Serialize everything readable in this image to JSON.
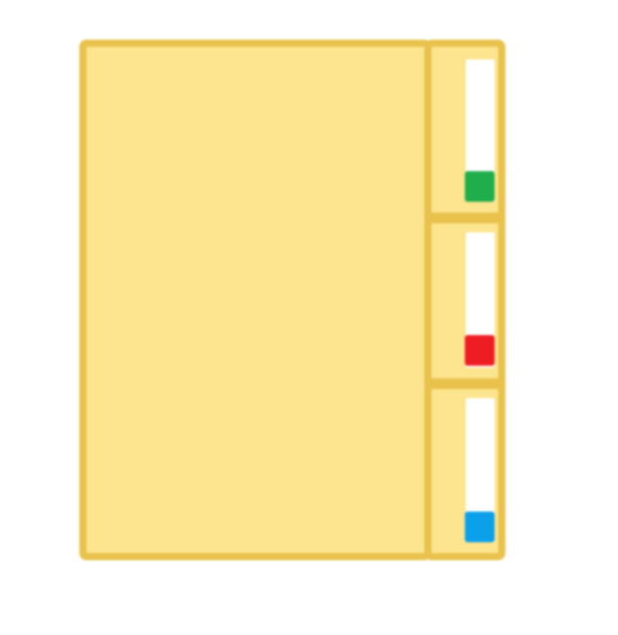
{
  "icon": {
    "name": "split-panel-icon",
    "colors": {
      "background": "#ffffff",
      "panel_fill": "#fde48e",
      "panel_border": "#e8c24c",
      "slot_fill": "#ffffff",
      "indicator_top": "#1fae4b",
      "indicator_middle": "#ee1d24",
      "indicator_bottom": "#0aa0ea"
    },
    "indicators": [
      {
        "name": "green-indicator",
        "color_key": "indicator_top"
      },
      {
        "name": "red-indicator",
        "color_key": "indicator_middle"
      },
      {
        "name": "blue-indicator",
        "color_key": "indicator_bottom"
      }
    ]
  }
}
